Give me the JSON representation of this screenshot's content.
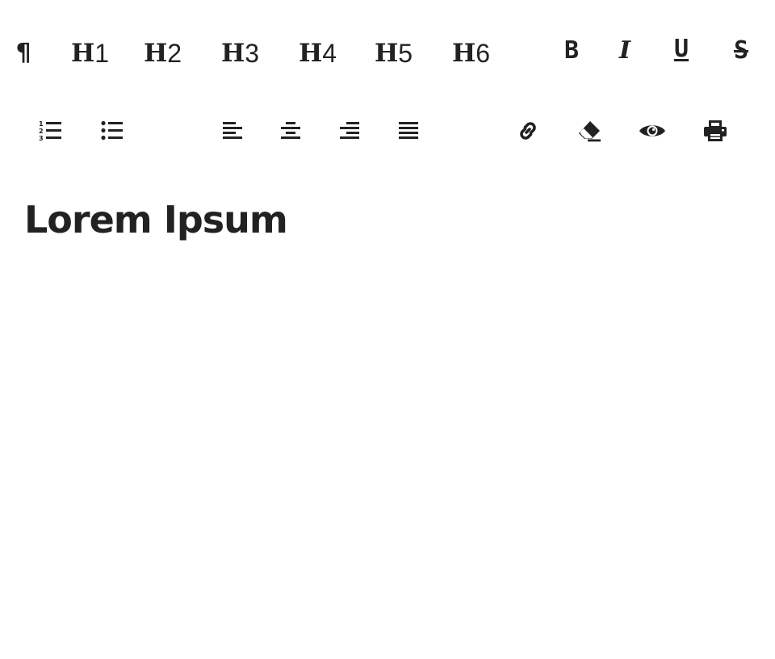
{
  "toolbar": {
    "paragraph": {
      "icon": "paragraph-icon",
      "glyph": "¶"
    },
    "headings": [
      {
        "letter": "H",
        "level": "1"
      },
      {
        "letter": "H",
        "level": "2"
      },
      {
        "letter": "H",
        "level": "3"
      },
      {
        "letter": "H",
        "level": "4"
      },
      {
        "letter": "H",
        "level": "5"
      },
      {
        "letter": "H",
        "level": "6"
      }
    ],
    "format": {
      "bold": "B",
      "italic": "I",
      "underline": "U",
      "strikethrough": "S"
    },
    "icons": [
      "ordered-list-icon",
      "unordered-list-icon",
      "align-left-icon",
      "align-center-icon",
      "align-right-icon",
      "align-justify-icon",
      "link-icon",
      "eraser-icon",
      "eye-icon",
      "print-icon"
    ]
  },
  "editor": {
    "heading": "Lorem Ipsum"
  },
  "colors": {
    "icon": "#222222",
    "background": "#ffffff"
  }
}
